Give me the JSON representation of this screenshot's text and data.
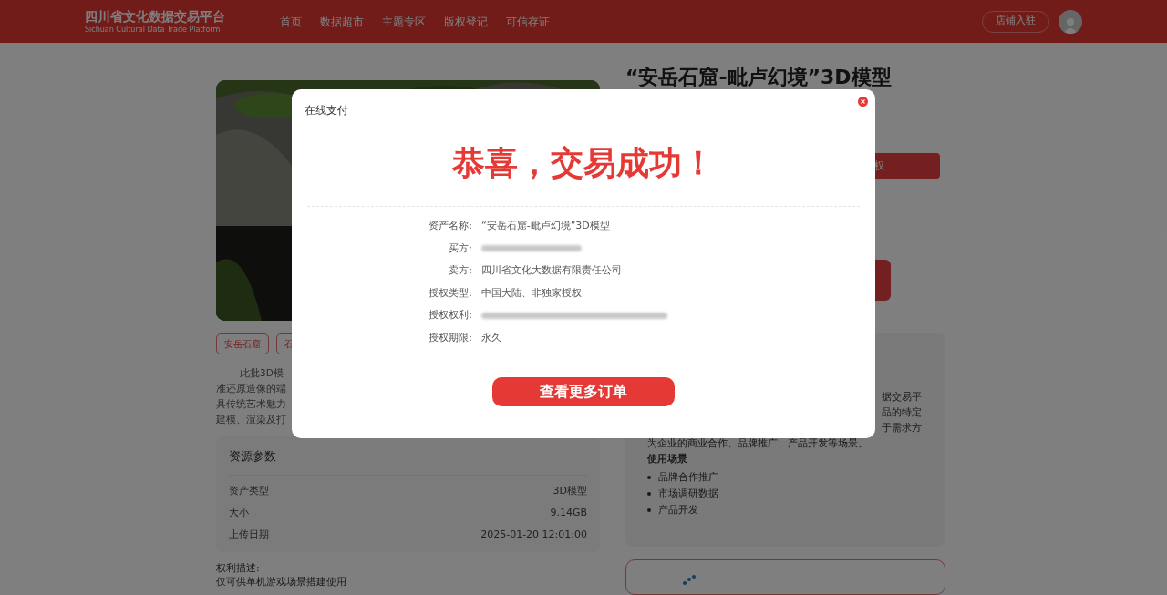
{
  "header": {
    "logo_title": "四川省文化数据交易平台",
    "logo_subtitle": "Sichuan Cultural Data Trade Platform",
    "nav": [
      "首页",
      "数据超市",
      "主题专区",
      "版权登记",
      "可信存证"
    ],
    "join_button": "店铺入驻"
  },
  "product": {
    "title": "“安岳石窟-毗卢幻境”3D模型",
    "tags": [
      "安岳石窟",
      "石"
    ],
    "description_lines": [
      "此批3D模",
      "准还原造像的端",
      "具传统艺术魅力",
      "建模、渲染及打"
    ],
    "action_button": "权",
    "params": {
      "title": "资源参数",
      "rows": [
        {
          "label": "资产类型",
          "value": "3D模型"
        },
        {
          "label": "大小",
          "value": "9.14GB"
        },
        {
          "label": "上传日期",
          "value": "2025-01-20 12:01:00"
        }
      ]
    },
    "rights": {
      "label": "权利描述:",
      "text": "仅可供单机游戏场景搭建使用"
    }
  },
  "info_card": {
    "line_ends": [
      "据交易平",
      "品的特定",
      "于需求方"
    ],
    "line": "为企业的商业合作、品牌推广、产品开发等场景。",
    "scenario_title": "使用场景",
    "scenarios": [
      "品牌合作推广",
      "市场调研数据",
      "产品开发"
    ]
  },
  "modal": {
    "title": "在线支付",
    "heading": "恭喜，交易成功！",
    "fields": [
      {
        "kind": "text",
        "label": "资产名称:",
        "value": "“安岳石窟-毗卢幻境”3D模型"
      },
      {
        "kind": "blurred",
        "label": "买方:"
      },
      {
        "kind": "text",
        "label": "卖方:",
        "value": "四川省文化大数据有限责任公司"
      },
      {
        "kind": "text",
        "label": "授权类型:",
        "value": "中国大陆、非独家授权"
      },
      {
        "kind": "blurred",
        "label": "授权权利:"
      },
      {
        "kind": "text",
        "label": "授权期限:",
        "value": "永久"
      }
    ],
    "button": "查看更多订单"
  }
}
